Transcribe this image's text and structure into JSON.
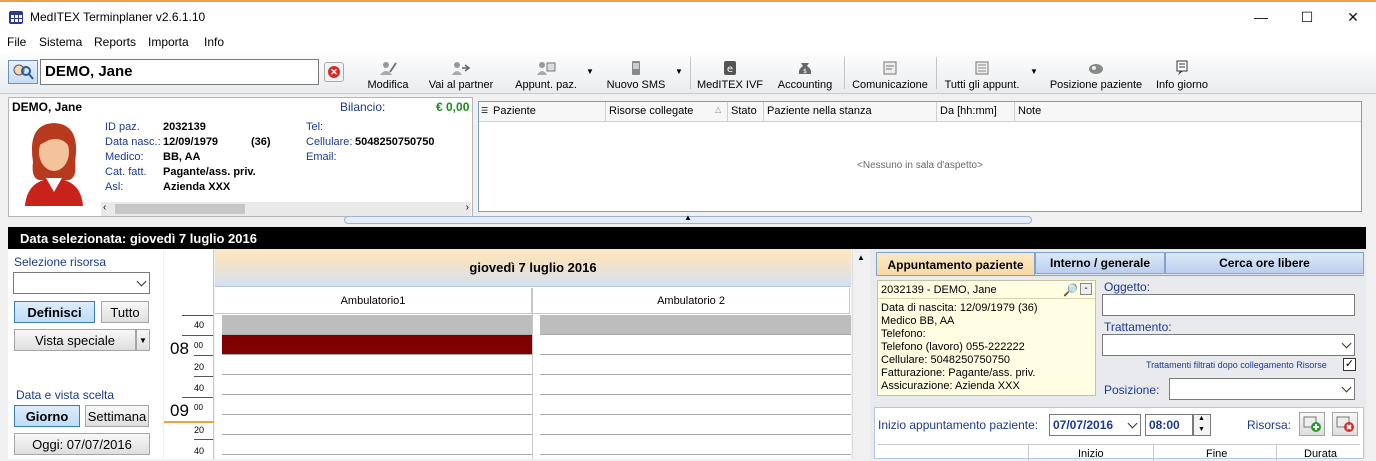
{
  "window": {
    "title": "MedITEX Terminplaner  v2.6.1.10",
    "minimize": "—",
    "maximize": "☐",
    "close": "✕"
  },
  "menu": [
    "File",
    "Sistema",
    "Reports",
    "Importa",
    "Info"
  ],
  "search": {
    "patient_value": "DEMO, Jane"
  },
  "toolbar": {
    "modifica": "Modifica",
    "vai_al_partner": "Vai al partner",
    "appunt_paz": "Appunt. paz.",
    "nuovo_sms": "Nuovo SMS",
    "meditex_ivf": "MedITEX IVF",
    "accounting": "Accounting",
    "comunicazione": "Comunicazione",
    "tutti_gli_appunt": "Tutti gli appunt.",
    "posizione_paziente": "Posizione paziente",
    "info_giorno": "Info giorno"
  },
  "patient": {
    "name": "DEMO, Jane",
    "bilancio_label": "Bilancio:",
    "bilancio_value": "€ 0,00",
    "fields": {
      "id_label": "ID paz.",
      "id": "2032139",
      "dob_label": "Data nasc.:",
      "dob": "12/09/1979",
      "age": "(36)",
      "medico_label": "Medico:",
      "medico": "BB, AA",
      "cat_label": "Cat. fatt.",
      "cat": "Pagante/ass. priv.",
      "asl_label": "Asl:",
      "asl": "Azienda XXX",
      "tel_label": "Tel:",
      "tel": "",
      "cell_label": "Cellulare:",
      "cell": "5048250750750",
      "email_label": "Email:",
      "email": ""
    }
  },
  "waiting_room": {
    "columns": [
      "Paziente",
      "Risorse collegate",
      "Stato",
      "Paziente nella stanza",
      "Da [hh:mm]",
      "Note"
    ],
    "empty_text": "<Nessuno in sala d'aspetto>"
  },
  "selected_date": "Data selezionata:  giovedì 7 luglio 2016",
  "left_panel": {
    "selezione_risorsa": "Selezione risorsa",
    "definisci": "Definisci",
    "tutto": "Tutto",
    "vista_speciale": "Vista speciale",
    "data_e_vista": "Data e vista scelta",
    "giorno": "Giorno",
    "settimana": "Settimana",
    "oggi": "Oggi: 07/07/2016"
  },
  "timeline": {
    "labels": [
      {
        "t": "40",
        "kind": "min"
      },
      {
        "t": "08",
        "kind": "hour"
      },
      {
        "t": "00",
        "kind": "hm"
      },
      {
        "t": "20",
        "kind": "min"
      },
      {
        "t": "40",
        "kind": "min"
      },
      {
        "t": "09",
        "kind": "hour"
      },
      {
        "t": "00",
        "kind": "hm"
      },
      {
        "t": "20",
        "kind": "min"
      },
      {
        "t": "40",
        "kind": "min"
      }
    ]
  },
  "calendar": {
    "day_header": "giovedì 7 luglio 2016",
    "resources": [
      "Ambulatorio1",
      "Ambulatorio 2"
    ],
    "colors": {
      "booked": "#800000",
      "blocked": "#bdbdbd"
    }
  },
  "right_panel": {
    "tabs": [
      "Appuntamento paziente",
      "Interno / generale",
      "Cerca ore libere"
    ],
    "patient_card": {
      "header": "2032139 - DEMO, Jane",
      "lines": [
        "Data di nascita: 12/09/1979 (36)",
        "Medico BB, AA",
        "Telefono:",
        "Telefono (lavoro) 055-222222",
        "Cellulare: 5048250750750",
        "Fatturazione: Pagante/ass. priv.",
        "Assicurazione: Azienda XXX"
      ]
    },
    "oggetto_label": "Oggetto:",
    "trattamento_label": "Trattamento:",
    "filtro_label": "Trattamenti filtrati dopo collegamento Risorse",
    "filtro_checked": "✓",
    "posizione_label": "Posizione:",
    "inizio_label": "Inizio appuntamento paziente:",
    "date_value": "07/07/2016",
    "time_value": "08:00",
    "risorsa_label": "Risorsa:",
    "table_headers": [
      "Inizio",
      "Fine",
      "Durata"
    ]
  }
}
